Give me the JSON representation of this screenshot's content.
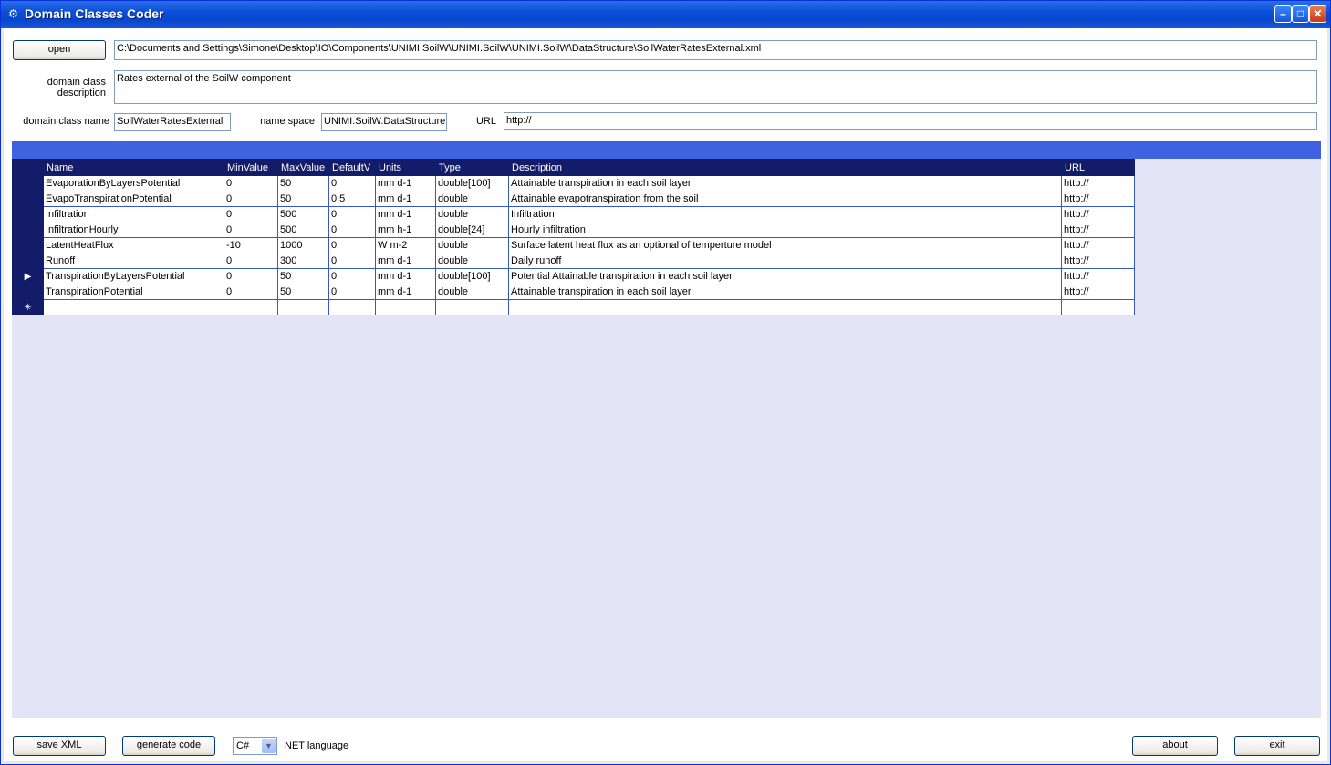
{
  "window": {
    "title": "Domain Classes Coder"
  },
  "top": {
    "open_label": "open",
    "file_path": "C:\\Documents and Settings\\Simone\\Desktop\\IO\\Components\\UNIMI.SoilW\\UNIMI.SoilW\\UNIMI.SoilW\\DataStructure\\SoilWaterRatesExternal.xml",
    "description_label_1": "domain class",
    "description_label_2": "description",
    "description_value": "Rates external of the SoilW component",
    "class_name_label": "domain class name",
    "class_name_value": "SoilWaterRatesExternal",
    "namespace_label": "name space",
    "namespace_value": "UNIMI.SoilW.DataStructure",
    "url_label": "URL",
    "url_value": "http://"
  },
  "grid": {
    "columns": [
      "Name",
      "MinValue",
      "MaxValue",
      "DefaultV",
      "Units",
      "Type",
      "Description",
      "URL"
    ],
    "rows": [
      [
        "EvaporationByLayersPotential",
        "0",
        "50",
        "0",
        "mm d-1",
        "double[100]",
        "Attainable transpiration in each soil layer",
        "http://"
      ],
      [
        "EvapoTranspirationPotential",
        "0",
        "50",
        "0.5",
        "mm d-1",
        "double",
        "Attainable evapotranspiration from the soil",
        "http://"
      ],
      [
        "Infiltration",
        "0",
        "500",
        "0",
        "mm d-1",
        "double",
        "Infiltration",
        "http://"
      ],
      [
        "InfiltrationHourly",
        "0",
        "500",
        "0",
        "mm h-1",
        "double[24]",
        "Hourly infiltration",
        "http://"
      ],
      [
        "LatentHeatFlux",
        "-10",
        "1000",
        "0",
        "W m-2",
        "double",
        "Surface latent heat flux as an optional of temperture model",
        "http://"
      ],
      [
        "Runoff",
        "0",
        "300",
        "0",
        "mm d-1",
        "double",
        "Daily runoff",
        "http://"
      ],
      [
        "TranspirationByLayersPotential",
        "0",
        "50",
        "0",
        "mm d-1",
        "double[100]",
        "Potential Attainable transpiration in each soil layer",
        "http://"
      ],
      [
        "TranspirationPotential",
        "0",
        "50",
        "0",
        "mm d-1",
        "double",
        "Attainable transpiration in each soil layer",
        "http://"
      ]
    ],
    "current_row_marker": "▶",
    "new_row_marker": "✳"
  },
  "bottom": {
    "save_xml_label": "save XML",
    "generate_code_label": "generate code",
    "language_value": "C#",
    "language_label": "NET language",
    "about_label": "about",
    "exit_label": "exit"
  }
}
